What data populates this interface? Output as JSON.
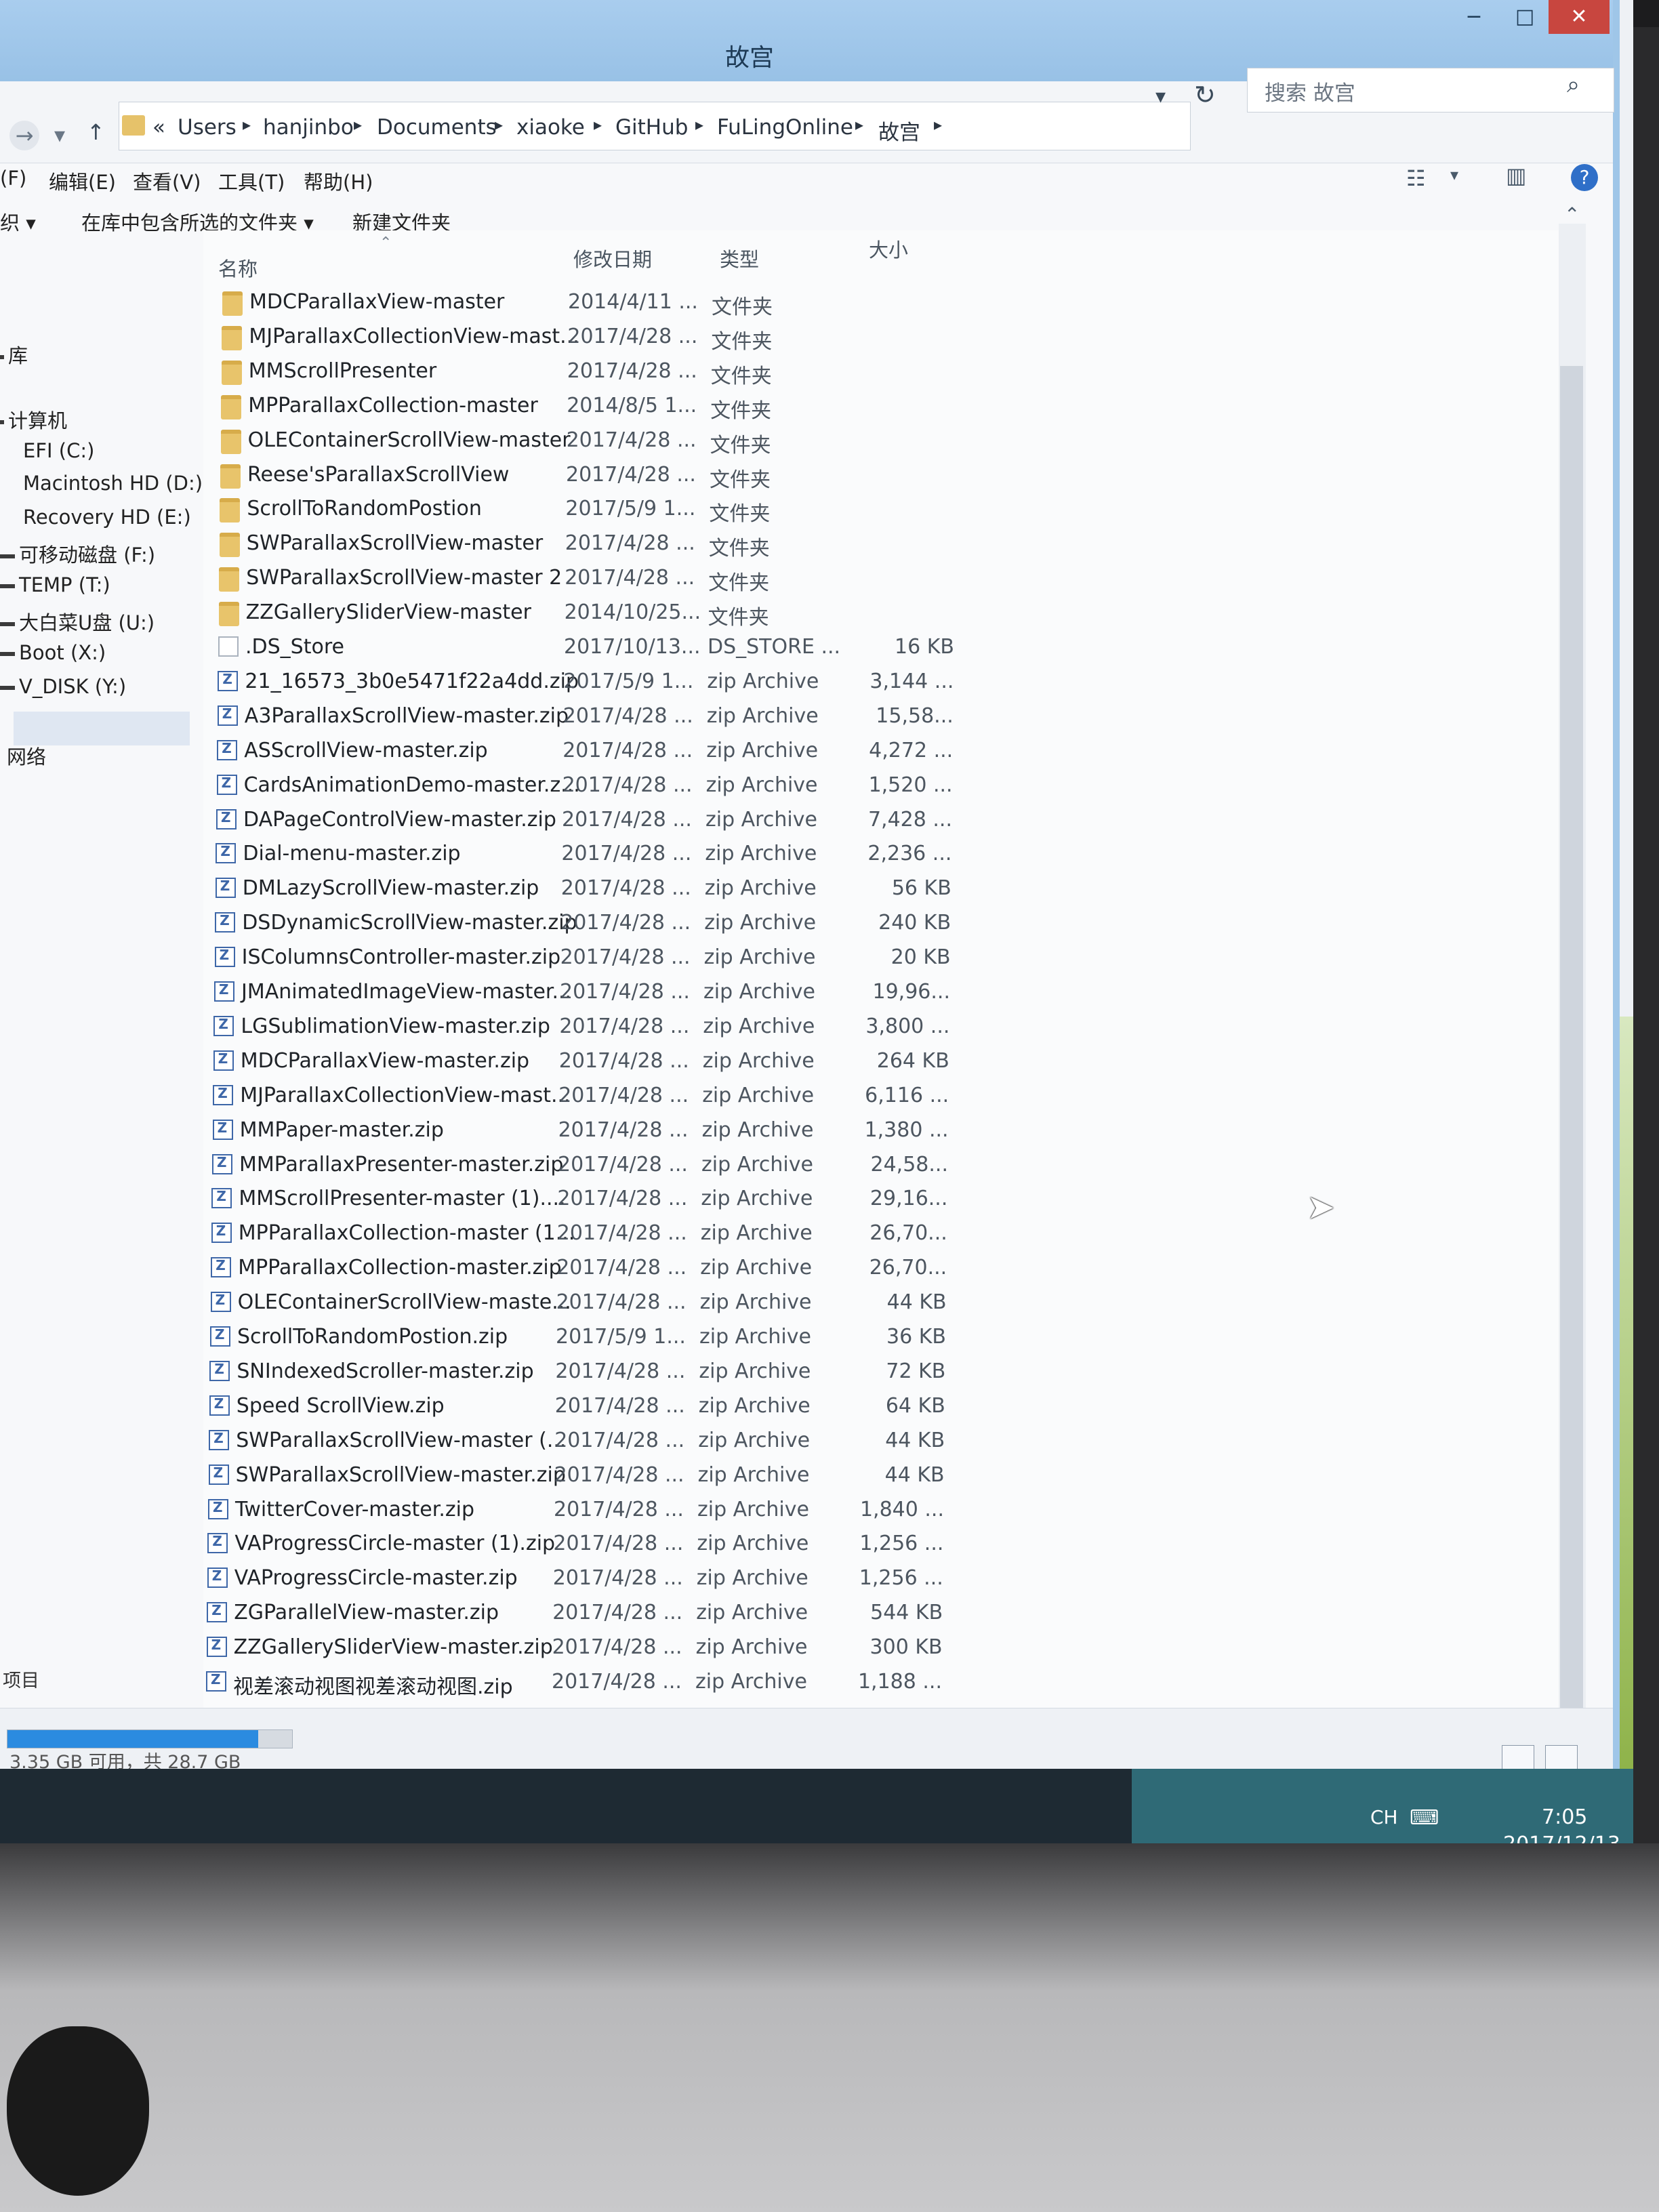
{
  "window": {
    "title": "故宫",
    "min": "−",
    "max": "□",
    "close": "✕"
  },
  "address": {
    "prefix": "«",
    "crumbs": [
      "Users",
      "hanjinbo",
      "Documents",
      "xiaoke",
      "GitHub",
      "FuLingOnline",
      "故宫"
    ],
    "search_placeholder": "搜索 故宫"
  },
  "menu": [
    "(F)",
    "编辑(E)",
    "查看(V)",
    "工具(T)",
    "帮助(H)"
  ],
  "toolbar": {
    "organize": "织 ▾",
    "include": "在库中包含所选的文件夹 ▾",
    "new_folder": "新建文件夹"
  },
  "nav": {
    "library": "库",
    "computer": "计算机",
    "drives": [
      "EFI (C:)",
      "Macintosh HD (D:)",
      "Recovery HD (E:)",
      "可移动磁盘 (F:)",
      "TEMP (T:)",
      "大白菜U盘 (U:)",
      "Boot (X:)",
      "V_DISK (Y:)"
    ],
    "network": "网络"
  },
  "columns": {
    "name": "名称",
    "date": "修改日期",
    "type": "类型",
    "size": "大小"
  },
  "files": [
    {
      "name": "MDCParallaxView-master",
      "date": "2014/4/11 ...",
      "type": "文件夹",
      "size": "",
      "kind": "folder"
    },
    {
      "name": "MJParallaxCollectionView-mast...",
      "date": "2017/4/28 ...",
      "type": "文件夹",
      "size": "",
      "kind": "folder"
    },
    {
      "name": "MMScrollPresenter",
      "date": "2017/4/28 ...",
      "type": "文件夹",
      "size": "",
      "kind": "folder"
    },
    {
      "name": "MPParallaxCollection-master",
      "date": "2014/8/5 1...",
      "type": "文件夹",
      "size": "",
      "kind": "folder"
    },
    {
      "name": "OLEContainerScrollView-master",
      "date": "2017/4/28 ...",
      "type": "文件夹",
      "size": "",
      "kind": "folder"
    },
    {
      "name": "Reese'sParallaxScrollView",
      "date": "2017/4/28 ...",
      "type": "文件夹",
      "size": "",
      "kind": "folder"
    },
    {
      "name": "ScrollToRandomPostion",
      "date": "2017/5/9 1...",
      "type": "文件夹",
      "size": "",
      "kind": "folder"
    },
    {
      "name": "SWParallaxScrollView-master",
      "date": "2017/4/28 ...",
      "type": "文件夹",
      "size": "",
      "kind": "folder"
    },
    {
      "name": "SWParallaxScrollView-master 2",
      "date": "2017/4/28 ...",
      "type": "文件夹",
      "size": "",
      "kind": "folder"
    },
    {
      "name": "ZZGallerySliderView-master",
      "date": "2014/10/25...",
      "type": "文件夹",
      "size": "",
      "kind": "folder"
    },
    {
      "name": ".DS_Store",
      "date": "2017/10/13...",
      "type": "DS_STORE ...",
      "size": "16 KB",
      "kind": "file"
    },
    {
      "name": "21_16573_3b0e5471f22a4dd.zip",
      "date": "2017/5/9 1...",
      "type": "zip Archive",
      "size": "3,144 ...",
      "kind": "zip"
    },
    {
      "name": "A3ParallaxScrollView-master.zip",
      "date": "2017/4/28 ...",
      "type": "zip Archive",
      "size": "15,58...",
      "kind": "zip"
    },
    {
      "name": "ASScrollView-master.zip",
      "date": "2017/4/28 ...",
      "type": "zip Archive",
      "size": "4,272 ...",
      "kind": "zip"
    },
    {
      "name": "CardsAnimationDemo-master.z...",
      "date": "2017/4/28 ...",
      "type": "zip Archive",
      "size": "1,520 ...",
      "kind": "zip"
    },
    {
      "name": "DAPageControlView-master.zip",
      "date": "2017/4/28 ...",
      "type": "zip Archive",
      "size": "7,428 ...",
      "kind": "zip"
    },
    {
      "name": "Dial-menu-master.zip",
      "date": "2017/4/28 ...",
      "type": "zip Archive",
      "size": "2,236 ...",
      "kind": "zip"
    },
    {
      "name": "DMLazyScrollView-master.zip",
      "date": "2017/4/28 ...",
      "type": "zip Archive",
      "size": "56 KB",
      "kind": "zip"
    },
    {
      "name": "DSDynamicScrollView-master.zip",
      "date": "2017/4/28 ...",
      "type": "zip Archive",
      "size": "240 KB",
      "kind": "zip"
    },
    {
      "name": "ISColumnsController-master.zip",
      "date": "2017/4/28 ...",
      "type": "zip Archive",
      "size": "20 KB",
      "kind": "zip"
    },
    {
      "name": "JMAnimatedImageView-master...",
      "date": "2017/4/28 ...",
      "type": "zip Archive",
      "size": "19,96...",
      "kind": "zip"
    },
    {
      "name": "LGSublimationView-master.zip",
      "date": "2017/4/28 ...",
      "type": "zip Archive",
      "size": "3,800 ...",
      "kind": "zip"
    },
    {
      "name": "MDCParallaxView-master.zip",
      "date": "2017/4/28 ...",
      "type": "zip Archive",
      "size": "264 KB",
      "kind": "zip"
    },
    {
      "name": "MJParallaxCollectionView-mast...",
      "date": "2017/4/28 ...",
      "type": "zip Archive",
      "size": "6,116 ...",
      "kind": "zip"
    },
    {
      "name": "MMPaper-master.zip",
      "date": "2017/4/28 ...",
      "type": "zip Archive",
      "size": "1,380 ...",
      "kind": "zip"
    },
    {
      "name": "MMParallaxPresenter-master.zip",
      "date": "2017/4/28 ...",
      "type": "zip Archive",
      "size": "24,58...",
      "kind": "zip"
    },
    {
      "name": "MMScrollPresenter-master (1)....",
      "date": "2017/4/28 ...",
      "type": "zip Archive",
      "size": "29,16...",
      "kind": "zip"
    },
    {
      "name": "MPParallaxCollection-master (1...",
      "date": "2017/4/28 ...",
      "type": "zip Archive",
      "size": "26,70...",
      "kind": "zip"
    },
    {
      "name": "MPParallaxCollection-master.zip",
      "date": "2017/4/28 ...",
      "type": "zip Archive",
      "size": "26,70...",
      "kind": "zip"
    },
    {
      "name": "OLEContainerScrollView-maste...",
      "date": "2017/4/28 ...",
      "type": "zip Archive",
      "size": "44 KB",
      "kind": "zip"
    },
    {
      "name": "ScrollToRandomPostion.zip",
      "date": "2017/5/9 1...",
      "type": "zip Archive",
      "size": "36 KB",
      "kind": "zip"
    },
    {
      "name": "SNIndexedScroller-master.zip",
      "date": "2017/4/28 ...",
      "type": "zip Archive",
      "size": "72 KB",
      "kind": "zip"
    },
    {
      "name": "Speed ScrollView.zip",
      "date": "2017/4/28 ...",
      "type": "zip Archive",
      "size": "64 KB",
      "kind": "zip"
    },
    {
      "name": "SWParallaxScrollView-master (...",
      "date": "2017/4/28 ...",
      "type": "zip Archive",
      "size": "44 KB",
      "kind": "zip"
    },
    {
      "name": "SWParallaxScrollView-master.zip",
      "date": "2017/4/28 ...",
      "type": "zip Archive",
      "size": "44 KB",
      "kind": "zip"
    },
    {
      "name": "TwitterCover-master.zip",
      "date": "2017/4/28 ...",
      "type": "zip Archive",
      "size": "1,840 ...",
      "kind": "zip"
    },
    {
      "name": "VAProgressCircle-master (1).zip",
      "date": "2017/4/28 ...",
      "type": "zip Archive",
      "size": "1,256 ...",
      "kind": "zip"
    },
    {
      "name": "VAProgressCircle-master.zip",
      "date": "2017/4/28 ...",
      "type": "zip Archive",
      "size": "1,256 ...",
      "kind": "zip"
    },
    {
      "name": "ZGParallelView-master.zip",
      "date": "2017/4/28 ...",
      "type": "zip Archive",
      "size": "544 KB",
      "kind": "zip"
    },
    {
      "name": "ZZGallerySliderView-master.zip",
      "date": "2017/4/28 ...",
      "type": "zip Archive",
      "size": "300 KB",
      "kind": "zip"
    },
    {
      "name": "视差滚动视图视差滚动视图.zip",
      "date": "2017/4/28 ...",
      "type": "zip Archive",
      "size": "1,188 ...",
      "kind": "zip"
    }
  ],
  "status": {
    "items_label": "项目",
    "disk_text": "3.35 GB 可用，共 28.7 GB",
    "disk_used_fraction": 0.88
  },
  "taskbar": {
    "ime": "CH",
    "time": "7:05",
    "date": "2017/12/13"
  },
  "colors": {
    "titlebar": "#a9cdee",
    "accent": "#2b8be0",
    "close_button": "#c8463f"
  }
}
